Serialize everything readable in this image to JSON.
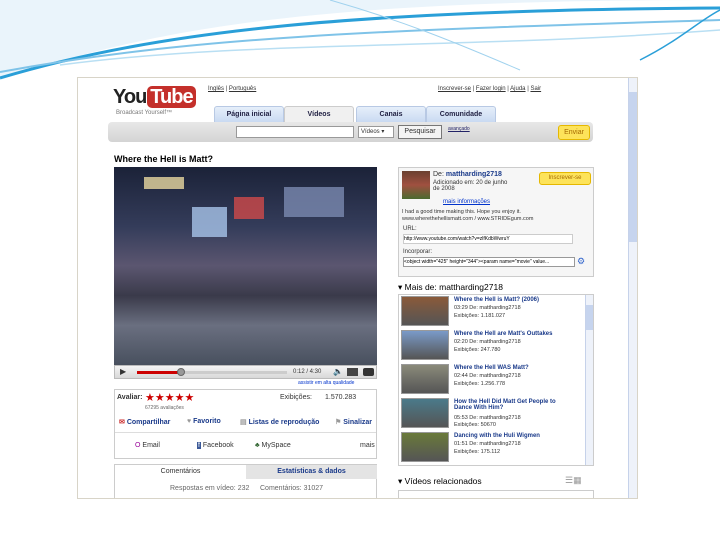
{
  "header": {
    "logo": "YouTube",
    "logo_you": "You",
    "logo_tube": "Tube",
    "tagline": "Broadcast Yourself™",
    "lang_links": [
      "Inglês",
      "Português"
    ],
    "user_links": [
      "Inscrever-se",
      "Fazer login",
      "Ajuda",
      "Sair"
    ]
  },
  "tabs": [
    "Página inicial",
    "Vídeos",
    "Canais",
    "Comunidade"
  ],
  "search": {
    "value": "",
    "select": "Vídeos",
    "button": "Pesquisar",
    "advanced": "avançado",
    "upload": "Enviar"
  },
  "video": {
    "title": "Where the Hell is Matt?",
    "time": "0:12 / 4:30",
    "hq_link": "assistir em alta qualidade",
    "progress_percent": 30
  },
  "rating": {
    "label": "Avaliar:",
    "stars": 5,
    "count": "67295 avaliações",
    "views_label": "Exibições:",
    "views": "1.570.283"
  },
  "actions": [
    "Compartilhar",
    "Favorito",
    "Listas de reprodução",
    "Sinalizar"
  ],
  "share": [
    "Email",
    "Facebook",
    "MySpace",
    "mais"
  ],
  "comment_tabs": [
    "Comentários",
    "Estatísticas & dados"
  ],
  "comment_stats": {
    "responses": "Respostas em vídeo: 232",
    "comments": "Comentários: 31027"
  },
  "channel": {
    "from": "De:",
    "user": "mattharding2718",
    "joined": "Adicionado em: 20 de junho de 2008",
    "more_info": "mais informações",
    "subscribe": "Inscrever-se",
    "description": "I had a good time making this. Hope you enjoy it. www.wherethehellismatt.com / www.STRIDEgum.com",
    "url_label": "URL:",
    "url": "http://www.youtube.com/watch?v=zlfKdbWwruY",
    "embed_label": "Incorporar:",
    "embed": "<object width=\"425\" height=\"344\"><param name=\"movie\" value..."
  },
  "more_from": {
    "label": "Mais de: mattharding2718",
    "items": [
      {
        "title": "Where the Hell is Matt? (2006)",
        "meta": "03:29 De: mattharding2718",
        "views": "Exibições: 1.181.027"
      },
      {
        "title": "Where the Hell are Matt's Outtakes",
        "meta": "02:20 De: mattharding2718",
        "views": "Exibições: 247.780"
      },
      {
        "title": "Where the Hell WAS Matt?",
        "meta": "02:44 De: mattharding2718",
        "views": "Exibições: 1.256.778"
      },
      {
        "title": "How the Hell Did Matt Get People to Dance With Him?",
        "meta": "05:53 De: mattharding2718",
        "views": "Exibições: 50670"
      },
      {
        "title": "Dancing with the Huli Wigmen",
        "meta": "01:51 De: mattharding2718",
        "views": "Exibições: 175.112"
      }
    ]
  },
  "related": {
    "label": "Vídeos relacionados"
  },
  "colors": {
    "slide_wave": "#2a9fd8",
    "youtube_red": "#c4302b",
    "link_blue": "#1a3a8a",
    "upload_yellow": "#fde35a"
  }
}
